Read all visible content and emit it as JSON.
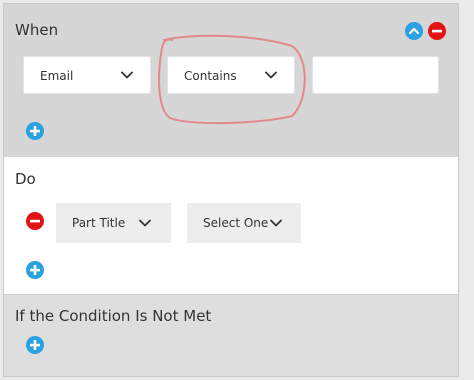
{
  "when": {
    "title": "When",
    "field_select": "Email",
    "operator_select": "Contains",
    "value_input": ""
  },
  "do": {
    "title": "Do",
    "action_select": "Part Title",
    "target_select": "Select One"
  },
  "else": {
    "title": "If the Condition Is Not Met"
  },
  "colors": {
    "add": "#2aa1e0",
    "remove": "#e21313",
    "annotation": "#e08a8a"
  }
}
